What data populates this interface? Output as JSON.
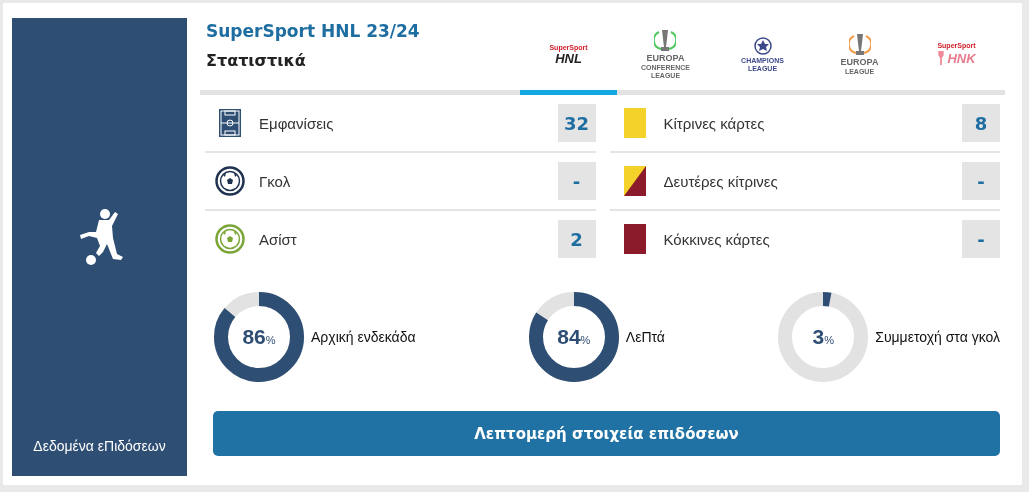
{
  "sidebar": {
    "label": "Δεδομένα εΠιδόσεων"
  },
  "header": {
    "competition": "SuperSport HNL 23/24",
    "title": "Στατιστικά"
  },
  "tabs": [
    {
      "kind": "hnl",
      "lines": [
        "SuperSport",
        "HNL"
      ],
      "selected": true
    },
    {
      "kind": "conference",
      "lines": [
        "EUROPA",
        "CONFERENCE",
        "LEAGUE"
      ],
      "selected": false
    },
    {
      "kind": "champions",
      "lines": [
        "CHAMPIONS",
        "LEAGUE"
      ],
      "selected": false
    },
    {
      "kind": "europa",
      "lines": [
        "EUROPA",
        "LEAGUE"
      ],
      "selected": false
    },
    {
      "kind": "hnk",
      "lines": [
        "SuperSport",
        "HNK"
      ],
      "selected": false
    }
  ],
  "stats_left": [
    {
      "kind": "pitch",
      "label": "Εμφανίσεις",
      "value": "32"
    },
    {
      "kind": "goal",
      "label": "Γκολ",
      "value": "-"
    },
    {
      "kind": "assist",
      "label": "Ασίστ",
      "value": "2"
    }
  ],
  "stats_right": [
    {
      "kind": "yellow",
      "label": "Κίτρινες κάρτες",
      "value": "8"
    },
    {
      "kind": "second_yellow",
      "label": "Δευτέρες κίτρινες",
      "value": "-"
    },
    {
      "kind": "red",
      "label": "Κόκκινες κάρτες",
      "value": "-"
    }
  ],
  "rings": [
    {
      "percent": "86",
      "unit": "%",
      "caption": "Αρχική ενδεκάδα"
    },
    {
      "percent": "84",
      "unit": "%",
      "caption": "ΛεΠτά"
    },
    {
      "percent": "3",
      "unit": "%",
      "caption": "Συμμετοχή στα γκολ"
    }
  ],
  "button": "Λεπτομερή στοιχεία επιδόσεων"
}
